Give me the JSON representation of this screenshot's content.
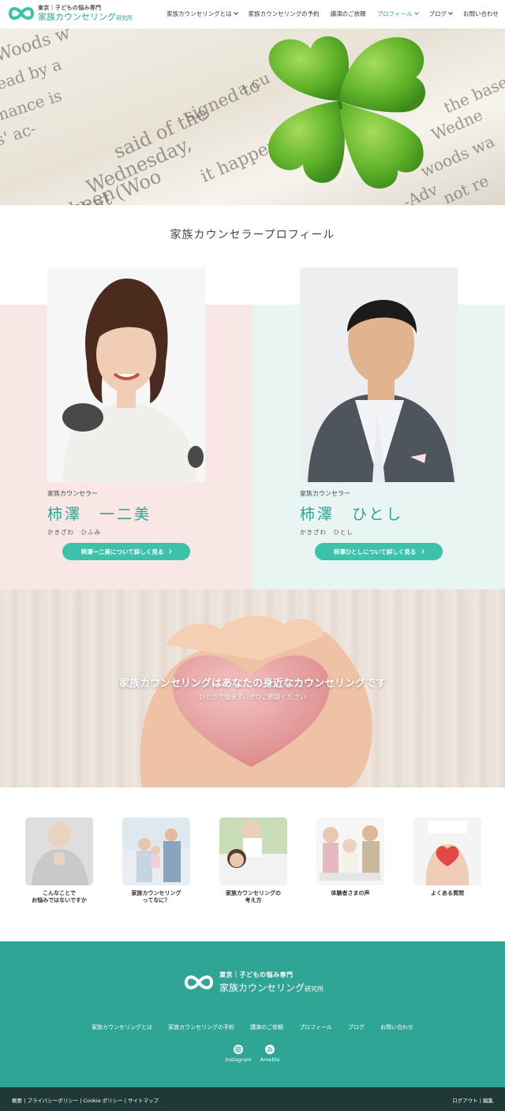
{
  "header": {
    "logo_line1": "東京｜子どもの悩み専門",
    "logo_line2": "家族カウンセリング",
    "logo_line2_small": "研究所",
    "nav": [
      {
        "label": "家族カウンセリングとは",
        "dropdown": true,
        "active": false
      },
      {
        "label": "家族カウンセリングの予約",
        "dropdown": false,
        "active": false
      },
      {
        "label": "講演のご依頼",
        "dropdown": false,
        "active": false
      },
      {
        "label": "プロフィール",
        "dropdown": true,
        "active": true
      },
      {
        "label": "ブログ",
        "dropdown": true,
        "active": false
      },
      {
        "label": "お問い合わせ",
        "dropdown": false,
        "active": false
      }
    ]
  },
  "hero": {
    "background_words": [
      "Woods w",
      "ead by a",
      "mance is",
      "s' ac-",
      "said of the",
      "Wednesday,",
      "signed to",
      "that (Woo",
      "has been",
      "it happened",
      "a cu",
      "the base",
      "Wedne",
      "woods wa",
      "not re",
      "-Adv"
    ]
  },
  "section_title": "家族カウンセラープロフィール",
  "profiles": [
    {
      "role": "家族カウンセラー",
      "name": "柿澤　一二美",
      "kana": "かきざわ　ひふみ",
      "button": "柿澤一二美について詳しく見る"
    },
    {
      "role": "家族カウンセラー",
      "name": "柿澤　ひとし",
      "kana": "かきざわ　ひとし",
      "button": "柿澤ひとしについて詳しく見る"
    }
  ],
  "banner": {
    "title": "家族カウンセリングはあなたの身近なカウンセリングです",
    "subtitle": "ひとりで悩まず、ぜひご相談ください"
  },
  "links": [
    {
      "line1": "こんなことで",
      "line2": "お悩みではないですか"
    },
    {
      "line1": "家族カウンセリング",
      "line2": "ってなに？"
    },
    {
      "line1": "家族カウンセリングの",
      "line2": "考え方"
    },
    {
      "line1": "体験者さまの声",
      "line2": ""
    },
    {
      "line1": "よくある質問",
      "line2": ""
    }
  ],
  "footer": {
    "logo_line1": "東京｜子どもの悩み専門",
    "logo_line2": "家族カウンセリング",
    "logo_line2_small": "研究所",
    "nav": [
      "家族カウンセリングとは",
      "家族カウンセリングの予約",
      "講演のご依頼",
      "プロフィール",
      "ブログ",
      "お問い合わせ"
    ],
    "social": [
      {
        "label": "Instagram",
        "icon": "instagram-icon"
      },
      {
        "label": "Ameblo",
        "icon": "ameblo-icon"
      }
    ],
    "bottom_left": "概要 | プライバシーポリシー | Cookie ポリシー | サイトマップ",
    "bottom_right": "ログアウト | 編集"
  },
  "colors": {
    "accent": "#2aa393",
    "button": "#3cc2a8",
    "footer": "#2fa596",
    "footer_bottom": "#1f3a36",
    "pink_band": "#f8e7e5",
    "mint_band": "#e8f5f2"
  }
}
